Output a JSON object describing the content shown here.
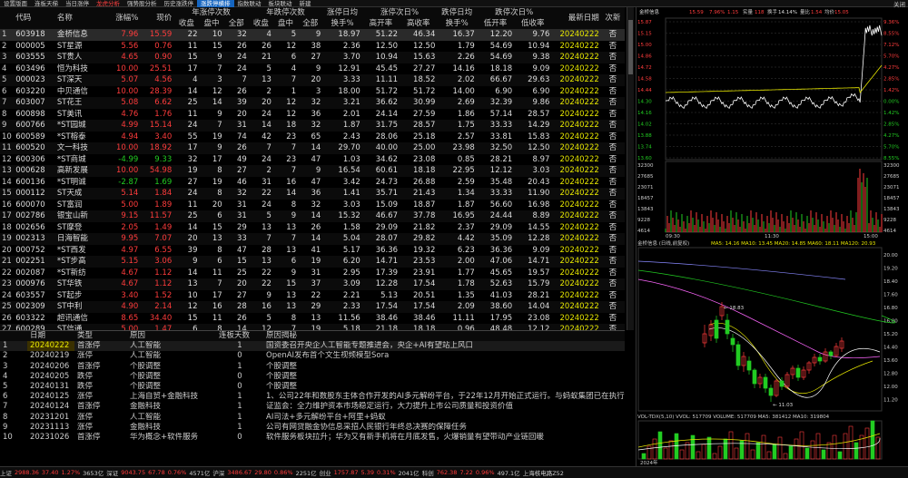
{
  "tabs": [
    {
      "label": "设置版面",
      "active": false,
      "red": false
    },
    {
      "label": "连板天梯",
      "active": false,
      "red": false
    },
    {
      "label": "当日涨停",
      "active": false,
      "red": false
    },
    {
      "label": "龙虎分析",
      "active": false,
      "red": true
    },
    {
      "label": "强势股分析",
      "active": false,
      "red": false
    },
    {
      "label": "历史涨跌停",
      "active": false,
      "red": false
    },
    {
      "label": "涨跌停横排",
      "active": true,
      "red": false
    },
    {
      "label": "指数联动",
      "active": false,
      "red": false
    },
    {
      "label": "板块联动",
      "active": false,
      "red": false
    },
    {
      "label": "新建",
      "active": false,
      "red": false
    }
  ],
  "close_label": "关闭",
  "table": {
    "group_headers": [
      "年涨停次数",
      "年跌停次数",
      "涨停日均",
      "涨停次日%",
      "跌停日均",
      "跌停次日%"
    ],
    "columns": [
      "代码",
      "名称",
      "涨幅%",
      "现价",
      "收盘",
      "盘中",
      "全部",
      "收盘",
      "盘中",
      "全部",
      "换手%",
      "高开率",
      "高收率",
      "换手%",
      "低开率",
      "低收率",
      "最新日期",
      "次新"
    ],
    "rows": [
      [
        "603918",
        "金桥信息",
        "7.96",
        "15.59",
        "22",
        "10",
        "32",
        "4",
        "5",
        "9",
        "18.97",
        "51.22",
        "46.34",
        "16.37",
        "12.20",
        "9.76",
        "20240222",
        "否"
      ],
      [
        "000005",
        "ST星源",
        "5.56",
        "0.76",
        "11",
        "15",
        "26",
        "26",
        "12",
        "38",
        "2.36",
        "12.50",
        "12.50",
        "1.79",
        "54.69",
        "10.94",
        "20240222",
        "否"
      ],
      [
        "603555",
        "ST贵人",
        "4.65",
        "0.90",
        "15",
        "9",
        "24",
        "21",
        "6",
        "27",
        "3.70",
        "10.94",
        "15.63",
        "2.26",
        "54.69",
        "9.38",
        "20240222",
        "否"
      ],
      [
        "603496",
        "恒为科技",
        "10.00",
        "25.51",
        "17",
        "7",
        "24",
        "5",
        "4",
        "9",
        "12.91",
        "45.45",
        "27.27",
        "14.16",
        "18.18",
        "9.09",
        "20240222",
        "否"
      ],
      [
        "000023",
        "ST深天",
        "5.07",
        "4.56",
        "4",
        "3",
        "7",
        "13",
        "7",
        "20",
        "3.33",
        "11.11",
        "18.52",
        "2.02",
        "66.67",
        "29.63",
        "20240222",
        "否"
      ],
      [
        "603220",
        "中贝通信",
        "10.00",
        "28.39",
        "14",
        "12",
        "26",
        "2",
        "1",
        "3",
        "18.00",
        "51.72",
        "51.72",
        "14.00",
        "6.90",
        "6.90",
        "20240222",
        "否"
      ],
      [
        "603007",
        "ST花王",
        "5.08",
        "6.62",
        "25",
        "14",
        "39",
        "20",
        "12",
        "32",
        "3.21",
        "36.62",
        "30.99",
        "2.69",
        "32.39",
        "9.86",
        "20240222",
        "否"
      ],
      [
        "600898",
        "ST美讯",
        "4.76",
        "1.76",
        "11",
        "9",
        "20",
        "24",
        "12",
        "36",
        "2.01",
        "24.14",
        "27.59",
        "1.86",
        "57.14",
        "28.57",
        "20240222",
        "否"
      ],
      [
        "600766",
        "*ST园城",
        "4.99",
        "15.14",
        "24",
        "7",
        "31",
        "14",
        "18",
        "32",
        "1.87",
        "31.75",
        "28.57",
        "1.75",
        "33.33",
        "14.29",
        "20240222",
        "否"
      ],
      [
        "600589",
        "*ST榕泰",
        "4.94",
        "3.40",
        "55",
        "19",
        "74",
        "42",
        "23",
        "65",
        "2.43",
        "28.06",
        "25.18",
        "2.57",
        "33.81",
        "15.83",
        "20240222",
        "否"
      ],
      [
        "600520",
        "文一科技",
        "10.00",
        "18.92",
        "17",
        "9",
        "26",
        "7",
        "7",
        "14",
        "29.70",
        "40.00",
        "25.00",
        "23.98",
        "32.50",
        "12.50",
        "20240222",
        "否"
      ],
      [
        "600306",
        "*ST商城",
        "-4.99",
        "9.33",
        "32",
        "17",
        "49",
        "24",
        "23",
        "47",
        "1.03",
        "34.62",
        "23.08",
        "0.85",
        "28.21",
        "8.97",
        "20240222",
        "否"
      ],
      [
        "000628",
        "高新发展",
        "10.00",
        "54.98",
        "19",
        "8",
        "27",
        "2",
        "7",
        "9",
        "16.54",
        "60.61",
        "18.18",
        "22.95",
        "12.12",
        "3.03",
        "20240222",
        "否"
      ],
      [
        "600136",
        "*ST明诚",
        "-2.87",
        "1.69",
        "27",
        "19",
        "46",
        "31",
        "16",
        "47",
        "3.42",
        "24.73",
        "26.88",
        "2.59",
        "35.48",
        "20.43",
        "20240222",
        "否"
      ],
      [
        "000112",
        "ST天成",
        "5.14",
        "1.84",
        "24",
        "8",
        "32",
        "22",
        "14",
        "36",
        "1.41",
        "35.71",
        "21.43",
        "1.34",
        "33.33",
        "11.90",
        "20240222",
        "否"
      ],
      [
        "600070",
        "ST富润",
        "5.00",
        "1.89",
        "11",
        "20",
        "31",
        "24",
        "8",
        "32",
        "3.03",
        "15.09",
        "18.87",
        "1.87",
        "56.60",
        "16.98",
        "20240222",
        "否"
      ],
      [
        "002786",
        "银宝山新",
        "9.15",
        "11.57",
        "25",
        "6",
        "31",
        "5",
        "9",
        "14",
        "15.32",
        "46.67",
        "37.78",
        "16.95",
        "24.44",
        "8.89",
        "20240222",
        "否"
      ],
      [
        "002656",
        "ST摩登",
        "2.05",
        "1.49",
        "14",
        "15",
        "29",
        "13",
        "13",
        "26",
        "1.58",
        "29.09",
        "21.82",
        "2.37",
        "29.09",
        "14.55",
        "20240222",
        "否"
      ],
      [
        "002313",
        "日海智能",
        "9.95",
        "7.07",
        "20",
        "13",
        "33",
        "7",
        "7",
        "14",
        "5.04",
        "28.07",
        "29.82",
        "4.42",
        "35.09",
        "12.28",
        "20240222",
        "否"
      ],
      [
        "000752",
        "*ST西发",
        "4.97",
        "6.55",
        "39",
        "8",
        "47",
        "28",
        "13",
        "41",
        "5.17",
        "36.36",
        "19.32",
        "6.23",
        "36.36",
        "9.09",
        "20240222",
        "否"
      ],
      [
        "002251",
        "*ST步高",
        "5.15",
        "3.06",
        "9",
        "6",
        "15",
        "13",
        "6",
        "19",
        "6.20",
        "14.71",
        "23.53",
        "2.00",
        "47.06",
        "14.71",
        "20240222",
        "否"
      ],
      [
        "002087",
        "*ST新纺",
        "4.67",
        "1.12",
        "14",
        "11",
        "25",
        "22",
        "9",
        "31",
        "2.95",
        "17.39",
        "23.91",
        "1.77",
        "45.65",
        "19.57",
        "20240222",
        "否"
      ],
      [
        "000976",
        "ST华铁",
        "4.67",
        "1.12",
        "13",
        "7",
        "20",
        "22",
        "15",
        "37",
        "3.09",
        "12.28",
        "17.54",
        "1.78",
        "52.63",
        "15.79",
        "20240222",
        "否"
      ],
      [
        "603557",
        "ST起步",
        "3.40",
        "1.52",
        "10",
        "17",
        "27",
        "9",
        "13",
        "22",
        "2.21",
        "5.13",
        "20.51",
        "1.35",
        "41.03",
        "28.21",
        "20240222",
        "否"
      ],
      [
        "002309",
        "ST中利",
        "4.90",
        "2.14",
        "12",
        "16",
        "28",
        "16",
        "13",
        "29",
        "2.33",
        "17.54",
        "17.54",
        "2.09",
        "38.60",
        "14.04",
        "20240222",
        "否"
      ],
      [
        "603322",
        "超讯通信",
        "8.65",
        "34.40",
        "15",
        "11",
        "26",
        "5",
        "8",
        "13",
        "11.56",
        "38.46",
        "38.46",
        "11.11",
        "17.95",
        "23.08",
        "20240222",
        "否"
      ],
      [
        "600289",
        "ST信通",
        "5.00",
        "1.47",
        "6",
        "8",
        "14",
        "12",
        "7",
        "19",
        "5.18",
        "21.18",
        "18.18",
        "0.96",
        "48.48",
        "12.12",
        "20240222",
        "否"
      ]
    ]
  },
  "reasons": {
    "columns": [
      "",
      "日期",
      "类型",
      "原因",
      "连板天数",
      "原因揭秘"
    ],
    "rows": [
      [
        "1",
        "20240222",
        "首涨停",
        "人工智能",
        "1",
        "国资委召开央企人工智能专题推进会，央企+AI有望站上风口"
      ],
      [
        "2",
        "20240219",
        "涨停",
        "人工智能",
        "0",
        "OpenAI发布首个文生视频模型Sora"
      ],
      [
        "3",
        "20240206",
        "首涨停",
        "个股调整",
        "1",
        "个股调整"
      ],
      [
        "4",
        "20240205",
        "跌停",
        "个股调整",
        "0",
        "个股调整"
      ],
      [
        "5",
        "20240131",
        "跌停",
        "个股调整",
        "0",
        "个股调整"
      ],
      [
        "6",
        "20240125",
        "涨停",
        "上海自贸+金融科技",
        "1",
        "1、公司22年和数股东主体合作开发的AI多元解纷平台，于22年12月开始正式运行。与蚂蚁集团已在执行、诉讼"
      ],
      [
        "7",
        "20240124",
        "首涨停",
        "金融科技",
        "1",
        "证监会：全力维护资本市场稳定运行，大力提升上市公司质量和投资价值"
      ],
      [
        "8",
        "20231201",
        "涨停",
        "人工智能",
        "1",
        "AI司法+多元解纷平台+阿里+蚂蚁"
      ],
      [
        "9",
        "20231113",
        "涨停",
        "金融科技",
        "1",
        "公司有网贷融金协信息采招人民银行年终总决赛的保障任务"
      ],
      [
        "10",
        "20231026",
        "首涨停",
        "华为概念+软件服务",
        "0",
        "软件服务板块拉升；华为又有新手机将在月底发售，火爆销量有望带动产业链回暖"
      ]
    ]
  },
  "chart": {
    "header": {
      "name": "金桥信息",
      "price": "15.59",
      "pct": "7.96%",
      "chg": "1.15",
      "label_qty": "实量",
      "qty": "118",
      "label_turnover": "换手",
      "turnover": "14.14%",
      "label_ratio": "量比",
      "ratio": "1.54",
      "label_low": "均价",
      "avg": "15.05"
    },
    "intraday_left_ticks": [
      "15.87",
      "15.15",
      "15.00",
      "14.86",
      "14.72",
      "14.58",
      "14.44",
      "14.30",
      "14.16",
      "14.02",
      "13.88",
      "13.74",
      "13.60"
    ],
    "intraday_right_ticks": [
      "9.36%",
      "8.55%",
      "7.12%",
      "5.70%",
      "4.27%",
      "2.85%",
      "1.42%",
      "0.00%",
      "1.42%",
      "2.85%",
      "4.27%",
      "5.70%",
      "8.55%"
    ],
    "volume_ticks": [
      "32300",
      "27685",
      "23071",
      "18457",
      "13843",
      "9228",
      "4614"
    ],
    "time_ticks": [
      "09:30",
      "11:30",
      "15:00"
    ],
    "kline_title": "金桥信息 (日线,前复权)",
    "kline_ma": "MA5: 14.16  MA10: 13.45  MA20: 14.85  MA60: 18.11  MA120: 20.93",
    "kline_max_label": "18.83",
    "kline_min_label": "11.03",
    "vol_title": "VOL-TDX(5,10)  VVOL: 517709  VOLUME: 517709  MA5: 381412  MA10: 319804",
    "kline_date": "2024年"
  },
  "status": {
    "items": [
      {
        "t": "上证",
        "c": "#ccc"
      },
      {
        "t": "2988.36",
        "c": "#ff3c3c"
      },
      {
        "t": "37.40",
        "c": "#ff3c3c"
      },
      {
        "t": "1.27%",
        "c": "#ff3c3c"
      },
      {
        "t": "3653亿",
        "c": "#ccc"
      },
      {
        "t": "深证",
        "c": "#ccc"
      },
      {
        "t": "9043.75",
        "c": "#ff3c3c"
      },
      {
        "t": "67.78",
        "c": "#ff3c3c"
      },
      {
        "t": "0.76%",
        "c": "#ff3c3c"
      },
      {
        "t": "4571亿",
        "c": "#ccc"
      },
      {
        "t": "沪深",
        "c": "#ccc"
      },
      {
        "t": "3486.67",
        "c": "#ff3c3c"
      },
      {
        "t": "29.80",
        "c": "#ff3c3c"
      },
      {
        "t": "0.86%",
        "c": "#ff3c3c"
      },
      {
        "t": "2251亿",
        "c": "#ccc"
      },
      {
        "t": "创业",
        "c": "#ccc"
      },
      {
        "t": "1757.87",
        "c": "#ff3c3c"
      },
      {
        "t": "5.39",
        "c": "#ff3c3c"
      },
      {
        "t": "0.31%",
        "c": "#ff3c3c"
      },
      {
        "t": "2041亿",
        "c": "#ccc"
      },
      {
        "t": "科创",
        "c": "#ccc"
      },
      {
        "t": "762.38",
        "c": "#ff3c3c"
      },
      {
        "t": "7.22",
        "c": "#ff3c3c"
      },
      {
        "t": "0.96%",
        "c": "#ff3c3c"
      },
      {
        "t": "497.1亿",
        "c": "#ccc"
      },
      {
        "t": "上海核电路Z52",
        "c": "#ccc"
      }
    ]
  }
}
